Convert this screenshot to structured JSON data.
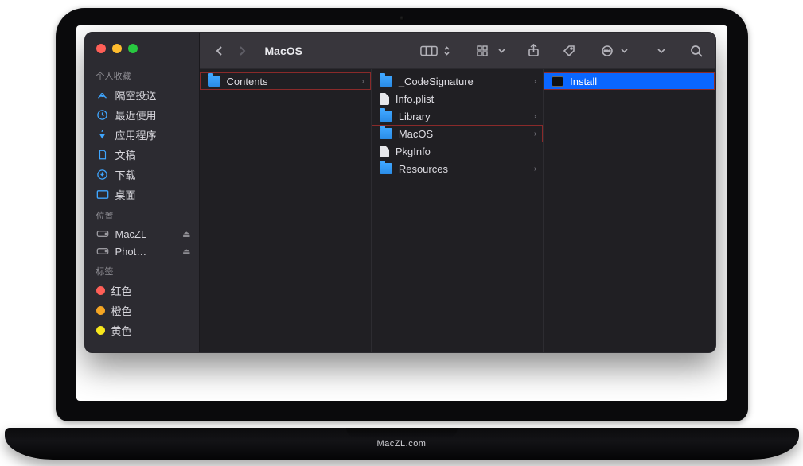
{
  "brand": "MacZL.com",
  "window": {
    "title": "MacOS"
  },
  "sidebar": {
    "sections": [
      {
        "title": "个人收藏",
        "items": [
          {
            "icon": "airdrop",
            "label": "隔空投送"
          },
          {
            "icon": "clock",
            "label": "最近使用"
          },
          {
            "icon": "apps",
            "label": "应用程序"
          },
          {
            "icon": "doc",
            "label": "文稿"
          },
          {
            "icon": "download",
            "label": "下载"
          },
          {
            "icon": "desktop",
            "label": "桌面"
          }
        ]
      },
      {
        "title": "位置",
        "items": [
          {
            "icon": "disk",
            "label": "MacZL",
            "eject": true
          },
          {
            "icon": "disk",
            "label": "Phot…",
            "eject": true
          }
        ]
      },
      {
        "title": "标签",
        "items": [
          {
            "icon": "tag",
            "color": "#ff5f57",
            "label": "红色"
          },
          {
            "icon": "tag",
            "color": "#f5a623",
            "label": "橙色"
          },
          {
            "icon": "tag",
            "color": "#f8e71c",
            "label": "黄色"
          }
        ]
      }
    ]
  },
  "columns": [
    {
      "items": [
        {
          "type": "folder",
          "label": "Contents",
          "arrow": true,
          "highlight": true
        }
      ]
    },
    {
      "items": [
        {
          "type": "folder",
          "label": "_CodeSignature",
          "arrow": true
        },
        {
          "type": "file",
          "label": "Info.plist"
        },
        {
          "type": "folder",
          "label": "Library",
          "arrow": true
        },
        {
          "type": "folder",
          "label": "MacOS",
          "arrow": true,
          "highlight": true
        },
        {
          "type": "file",
          "label": "PkgInfo"
        },
        {
          "type": "folder",
          "label": "Resources",
          "arrow": true
        }
      ]
    },
    {
      "items": [
        {
          "type": "exec",
          "label": "Install",
          "selected": true,
          "highlight": true
        }
      ]
    }
  ]
}
